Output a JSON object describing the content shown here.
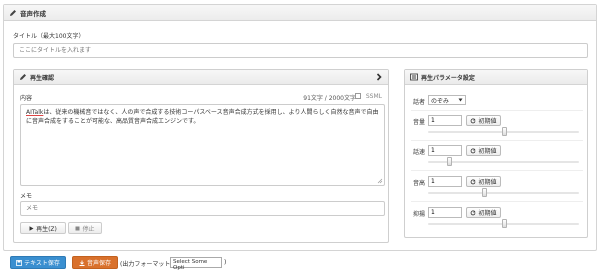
{
  "header": {
    "title": "音声作成",
    "icon": "pencil-icon"
  },
  "title_field": {
    "label": "タイトル（最大100文字）",
    "placeholder": "ここにタイトルを入れます"
  },
  "playback_panel": {
    "title": "再生確認",
    "content_label": "内容",
    "char_count": "91文字 / 2000文字",
    "ssml_label": "SSML",
    "ssml_checked": false,
    "content_highlight": "AITalk",
    "content_line1": "は、従来の機械音ではなく、人の声で合成する技術コーパスベース音声合成方式を採用し、より人間らしく自然な音声で自由",
    "content_line2": "に音声合成をすることが可能な、高品質音声合成エンジンです。",
    "memo_label": "メモ",
    "memo_placeholder": "メモ",
    "play_label": "再生(Z)",
    "stop_label": "停止"
  },
  "params_panel": {
    "title": "再生パラメータ設定",
    "speaker_label": "話者",
    "speaker_value": "のぞみ",
    "reset_label": "初期値",
    "params": [
      {
        "label": "音量",
        "value": "1",
        "level": 0.5
      },
      {
        "label": "話速",
        "value": "1",
        "level": 0.14
      },
      {
        "label": "音高",
        "value": "1",
        "level": 0.37
      },
      {
        "label": "抑揚",
        "value": "1",
        "level": 0.5
      }
    ]
  },
  "footer": {
    "text_save_label": "テキスト保存",
    "audio_save_label": "音声保存",
    "output_format_label": "(出力フォーマット :",
    "format_select_value": "Select Some Opti",
    "close_paren": ")"
  },
  "colors": {
    "text_save": "#3a8fd0",
    "audio_save": "#d9712c",
    "highlight_underline": "#dd4444"
  }
}
